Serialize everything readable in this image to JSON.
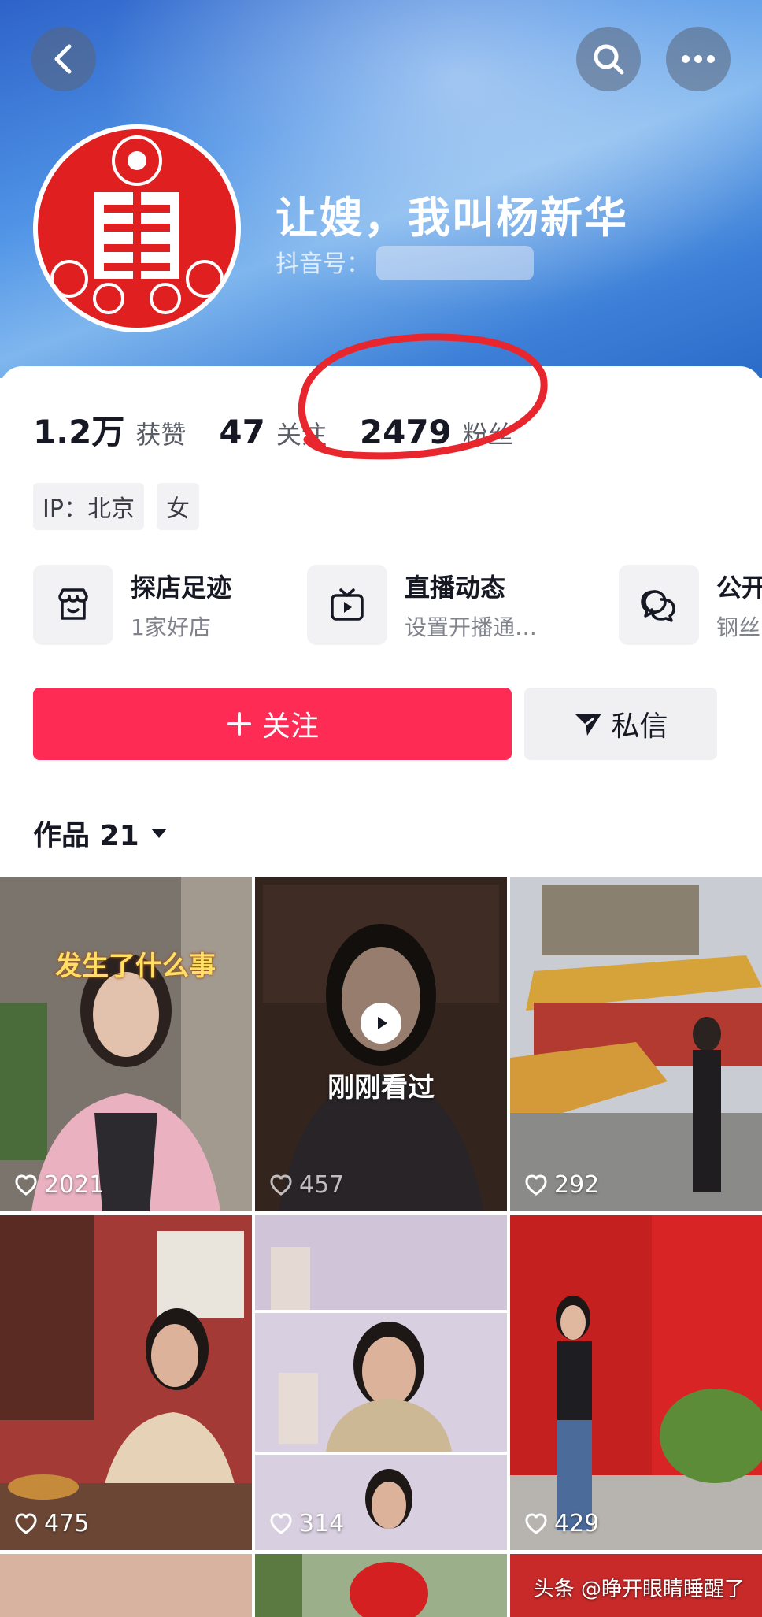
{
  "header": {
    "name": "让嫂，我叫杨新华",
    "uid_label": "抖音号："
  },
  "stats": [
    {
      "value": "1.2万",
      "label": "获赞"
    },
    {
      "value": "47",
      "label": "关注"
    },
    {
      "value": "2479",
      "label": "粉丝"
    }
  ],
  "tags": [
    "IP：北京",
    "女"
  ],
  "features": [
    {
      "title": "探店足迹",
      "subtitle": "1家好店"
    },
    {
      "title": "直播动态",
      "subtitle": "设置开播通…"
    },
    {
      "title": "公开",
      "subtitle": "钢丝"
    }
  ],
  "actions": {
    "follow_label": "关注",
    "message_label": "私信"
  },
  "works": {
    "label": "作品 21"
  },
  "videos": [
    {
      "likes": "2021",
      "caption": "发生了什么事"
    },
    {
      "likes": "457",
      "overlay": "刚刚看过"
    },
    {
      "likes": "292"
    },
    {
      "likes": "475"
    },
    {
      "likes": "314"
    },
    {
      "likes": "429"
    }
  ],
  "watermark": "头条 @睁开眼睛睡醒了",
  "colors": {
    "accent": "#fe2c55",
    "annotation": "#e8262e"
  }
}
